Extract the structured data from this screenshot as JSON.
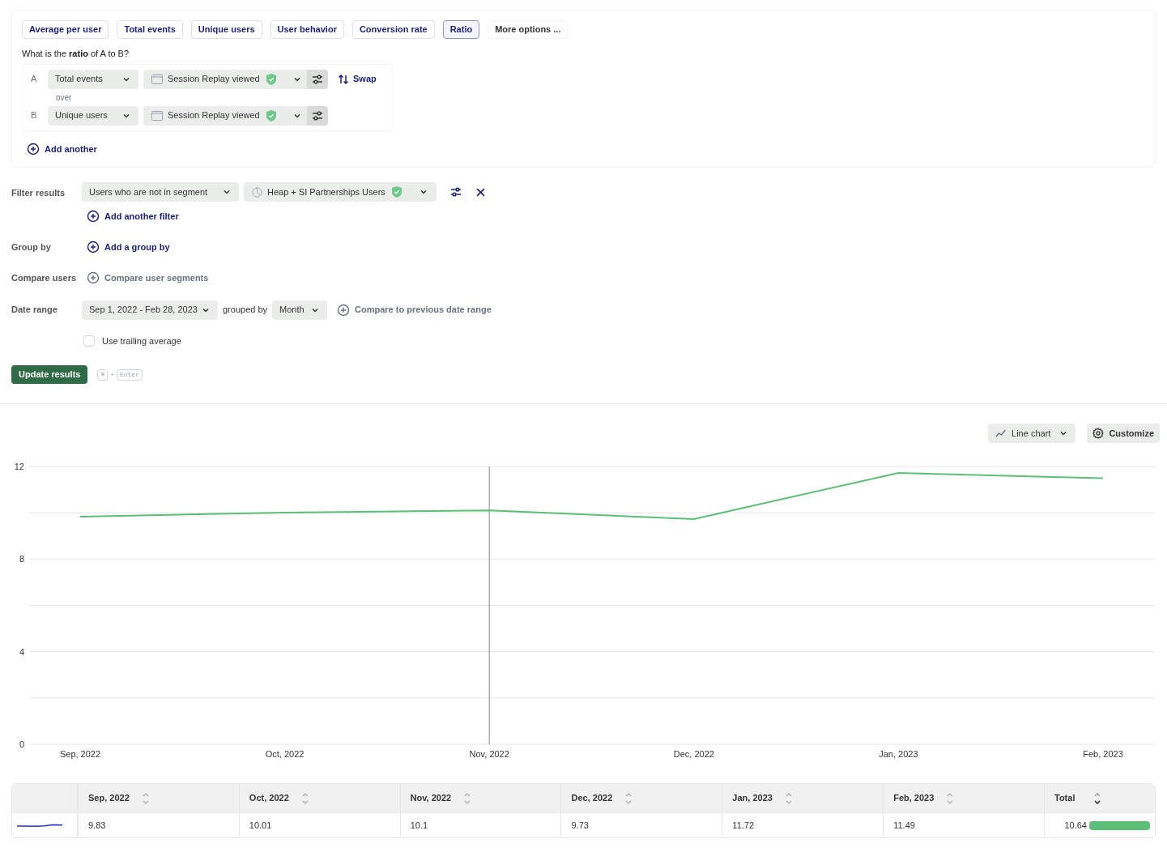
{
  "metric_tabs": [
    {
      "label": "Average per user",
      "selected": false
    },
    {
      "label": "Total events",
      "selected": false
    },
    {
      "label": "Unique users",
      "selected": false
    },
    {
      "label": "User behavior",
      "selected": false
    },
    {
      "label": "Conversion rate",
      "selected": false
    },
    {
      "label": "Ratio",
      "selected": true
    },
    {
      "label": "More options ...",
      "selected": false,
      "kind": "more"
    }
  ],
  "question": "What is the **ratio** of A to B?",
  "ratio": {
    "rows": [
      {
        "letter": "A",
        "measure": "Total events",
        "event": "Session Replay viewed"
      },
      {
        "letter": "B",
        "measure": "Unique users",
        "event": "Session Replay viewed"
      }
    ],
    "connector": "over",
    "swap": "Swap",
    "add": "Add another"
  },
  "filters": {
    "label": "Filter results",
    "condition": "Users who are not in segment",
    "segment": "Heap + SI Partnerships Users",
    "add": "Add another filter"
  },
  "group_by": {
    "label": "Group by",
    "add": "Add a group by"
  },
  "compare_users": {
    "label": "Compare users",
    "add": "Compare user segments"
  },
  "date_range": {
    "label": "Date range",
    "range": "Sep 1, 2022 - Feb 28, 2023",
    "grouped_label": "grouped by",
    "interval": "Month",
    "compare": "Compare to previous date range"
  },
  "trailing_average": {
    "label": "Use trailing average",
    "checked": false
  },
  "update_button": "Update results",
  "shortcut": [
    "⌘",
    "+",
    "Enter"
  ],
  "chart_toolbar": {
    "chart_type": "Line chart",
    "customize": "Customize"
  },
  "chart": {
    "chart_data": {
      "type": "line",
      "categories": [
        "Sep, 2022",
        "Oct, 2022",
        "Nov, 2022",
        "Dec, 2022",
        "Jan, 2023",
        "Feb, 2023"
      ],
      "series": [
        {
          "color": "#5bbf78",
          "values": [
            9.83,
            10.01,
            10.1,
            9.73,
            11.72,
            11.49
          ]
        }
      ],
      "ylim": [
        0,
        12
      ],
      "yticks": [
        0,
        4,
        8,
        12
      ],
      "ref_lines": [
        {
          "axis": "x",
          "value": "Nov, 2022"
        }
      ]
    }
  },
  "table": {
    "columns": [
      {
        "label": "Sep, 2022",
        "sorted": false
      },
      {
        "label": "Oct, 2022",
        "sorted": false
      },
      {
        "label": "Nov, 2022",
        "sorted": false
      },
      {
        "label": "Dec, 2022",
        "sorted": false
      },
      {
        "label": "Jan, 2023",
        "sorted": false
      },
      {
        "label": "Feb, 2023",
        "sorted": false
      }
    ],
    "total_column": {
      "label": "Total",
      "sorted": true
    },
    "rows": [
      {
        "cells": [
          "9.83",
          "10.01",
          "10.1",
          "9.73",
          "11.72",
          "11.49"
        ],
        "total": "10.64",
        "level": 1
      }
    ]
  }
}
